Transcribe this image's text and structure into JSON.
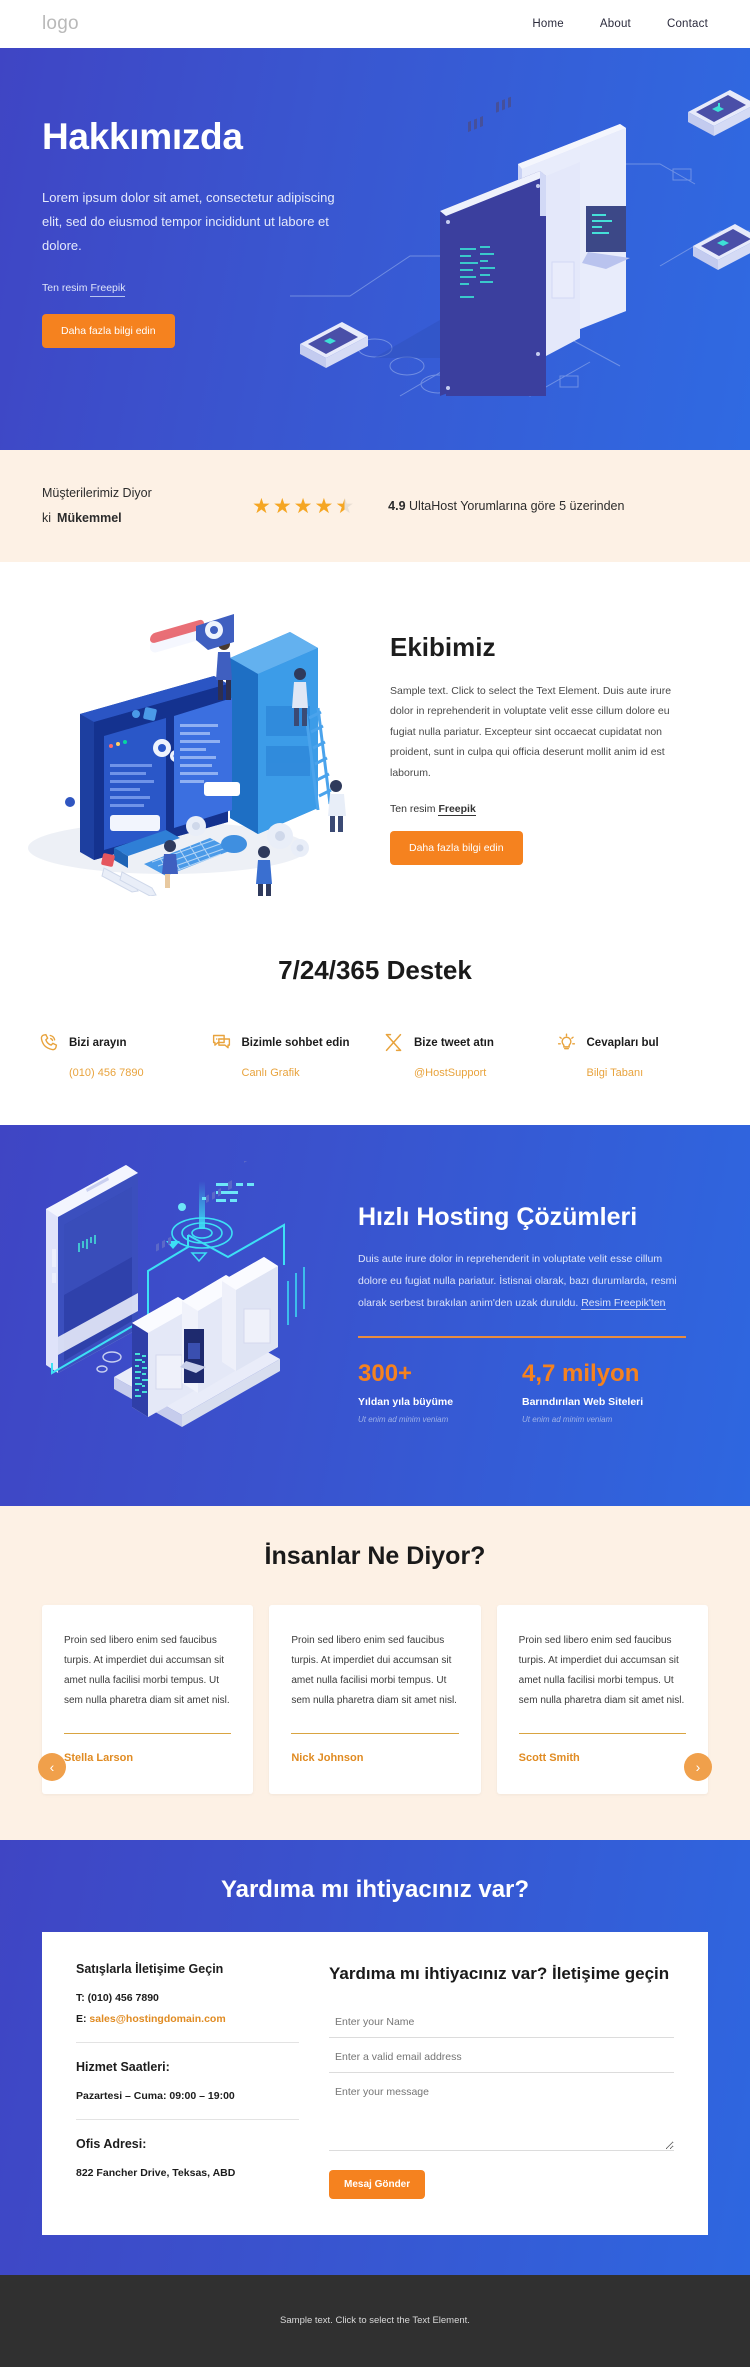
{
  "header": {
    "logo": "logo",
    "nav": [
      {
        "label": "Home"
      },
      {
        "label": "About"
      },
      {
        "label": "Contact"
      }
    ]
  },
  "hero": {
    "title": "Hakkımızda",
    "paragraph": "Lorem ipsum dolor sit amet, consectetur adipiscing elit, sed do eiusmod tempor incididunt ut labore et dolore.",
    "credit_prefix": "Ten resim ",
    "credit_link": "Freepik",
    "cta": "Daha fazla bilgi edin"
  },
  "reviews": {
    "line1": "Müşterilerimiz Diyor",
    "line2_prefix": "ki",
    "line2_bold": "Mükemmel",
    "rating": "4.9",
    "rating_text": "UltaHost Yorumlarına göre 5 üzerinden",
    "stars_full": 4,
    "stars_half": 1,
    "star_color": "#f5a623"
  },
  "team": {
    "title": "Ekibimiz",
    "paragraph": "Sample text. Click to select the Text Element. Duis aute irure dolor in reprehenderit in voluptate velit esse cillum dolore eu fugiat nulla pariatur. Excepteur sint occaecat cupidatat non proident, sunt in culpa qui officia deserunt mollit anim id est laborum.",
    "credit_prefix": "Ten resim ",
    "credit_link": "Freepik",
    "cta": "Daha fazla bilgi edin"
  },
  "support": {
    "title": "7/24/365 Destek",
    "items": [
      {
        "icon": "phone-icon",
        "label": "Bizi arayın",
        "sub": "(010) 456 7890"
      },
      {
        "icon": "chat-icon",
        "label": "Bizimle sohbet edin",
        "sub": "Canlı Grafik"
      },
      {
        "icon": "x-twitter-icon",
        "label": "Bize tweet atın",
        "sub": "@HostSupport"
      },
      {
        "icon": "lightbulb-icon",
        "label": "Cevapları bul",
        "sub": "Bilgi Tabanı"
      }
    ]
  },
  "hosting": {
    "title": "Hızlı Hosting Çözümleri",
    "paragraph": "Duis aute irure dolor in reprehenderit in voluptate velit esse cillum dolore eu fugiat nulla pariatur. İstisnai olarak, bazı durumlarda, resmi olarak serbest bırakılan anim'den uzak duruldu. ",
    "credit_link": "Resim Freepik'ten",
    "stats": [
      {
        "number": "300+",
        "label": "Yıldan yıla büyüme",
        "sub": "Ut enim ad minim veniam"
      },
      {
        "number": "4,7 milyon",
        "label": "Barındırılan Web Siteleri",
        "sub": "Ut enim ad minim veniam"
      }
    ]
  },
  "testimonials": {
    "title": "İnsanlar Ne Diyor?",
    "prev_icon": "chevron-left-icon",
    "next_icon": "chevron-right-icon",
    "cards": [
      {
        "text": "Proin sed libero enim sed faucibus turpis. At imperdiet dui accumsan sit amet nulla facilisi morbi tempus. Ut sem nulla pharetra diam sit amet nisl.",
        "author": "Stella Larson"
      },
      {
        "text": "Proin sed libero enim sed faucibus turpis. At imperdiet dui accumsan sit amet nulla facilisi morbi tempus. Ut sem nulla pharetra diam sit amet nisl.",
        "author": "Nick Johnson"
      },
      {
        "text": "Proin sed libero enim sed faucibus turpis. At imperdiet dui accumsan sit amet nulla facilisi morbi tempus. Ut sem nulla pharetra diam sit amet nisl.",
        "author": "Scott Smith"
      }
    ]
  },
  "contact": {
    "banner_title": "Yardıma mı ihtiyacınız var?",
    "sales_heading": "Satışlarla İletişime Geçin",
    "phone": "T: (010) 456 7890",
    "email_prefix": "E: ",
    "email": "sales@hostingdomain.com",
    "hours_heading": "Hizmet Saatleri:",
    "hours_value": "Pazartesi – Cuma: 09:00 – 19:00",
    "address_heading": "Ofis Adresi:",
    "address_value": "822 Fancher Drive, Teksas, ABD",
    "form_title": "Yardıma mı ihtiyacınız var? İletişime geçin",
    "name_placeholder": "Enter your Name",
    "email_placeholder": "Enter a valid email address",
    "message_placeholder": "Enter your message",
    "submit": "Mesaj Gönder"
  },
  "footer": {
    "text": "Sample text. Click to select the Text Element."
  },
  "theme": {
    "blue_start": "#3f45c4",
    "blue_end": "#2f6ae2",
    "orange": "#f5821f",
    "cream": "#fdf1e5",
    "footer_bg": "#303030"
  }
}
